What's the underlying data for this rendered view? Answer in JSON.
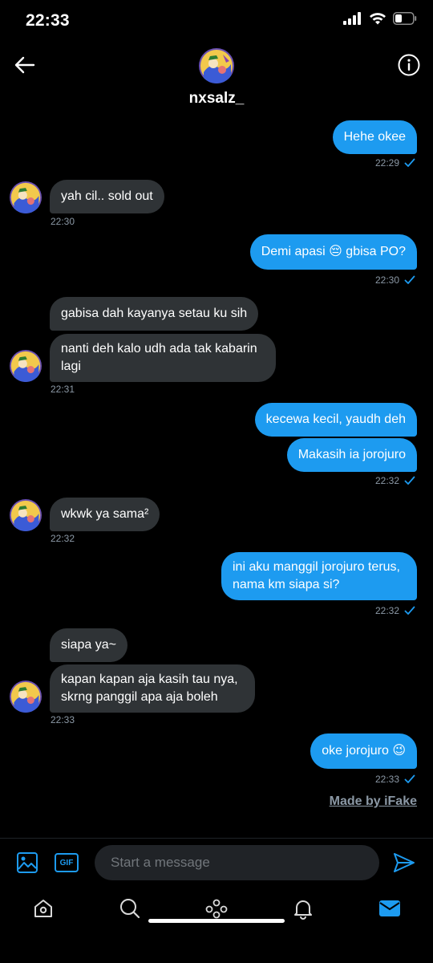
{
  "status_bar": {
    "time": "22:33"
  },
  "header": {
    "username": "nxsalz_"
  },
  "messages": [
    {
      "dir": "out",
      "text": "Hehe okee",
      "time": "22:29"
    },
    {
      "dir": "in",
      "text": "yah cil.. sold out",
      "time": "22:30"
    },
    {
      "dir": "out",
      "text": "Demi apasi 😔 gbisa PO?",
      "time": "22:30"
    },
    {
      "dir": "in",
      "text": "gabisa dah kayanya setau ku sih"
    },
    {
      "dir": "in",
      "text": "nanti deh kalo udh ada tak kabarin lagi",
      "time": "22:31"
    },
    {
      "dir": "out",
      "text": "kecewa kecil, yaudh deh"
    },
    {
      "dir": "out",
      "text": "Makasih ia jorojuro",
      "time": "22:32"
    },
    {
      "dir": "in",
      "text": "wkwk ya sama²",
      "time": "22:32"
    },
    {
      "dir": "out",
      "text": "ini aku manggil jorojuro terus, nama km siapa si?",
      "time": "22:32"
    },
    {
      "dir": "in",
      "text": "siapa ya~"
    },
    {
      "dir": "in",
      "text": "kapan kapan aja kasih tau nya, skrng panggil apa aja boleh",
      "time": "22:33"
    },
    {
      "dir": "out",
      "text": "oke jorojuro 😉",
      "time": "22:33"
    }
  ],
  "watermark": "Made by iFake",
  "composer": {
    "placeholder": "Start a message",
    "gif_label": "GIF"
  },
  "colors": {
    "accent": "#1d9bf0",
    "incoming": "#2f3336",
    "background": "#000000",
    "muted": "#8b98a5"
  }
}
